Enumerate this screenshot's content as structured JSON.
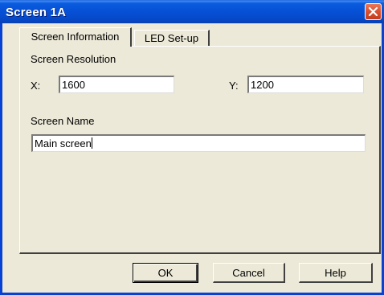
{
  "window": {
    "title": "Screen 1A",
    "close_label": "close"
  },
  "tabs": [
    {
      "label": "Screen Information",
      "active": true
    },
    {
      "label": "LED Set-up",
      "active": false
    }
  ],
  "screen_resolution": {
    "label": "Screen Resolution",
    "x_label": "X:",
    "x_value": "1600",
    "y_label": "Y:",
    "y_value": "1200"
  },
  "screen_name": {
    "label": "Screen Name",
    "value": "Main screen"
  },
  "buttons": {
    "ok": "OK",
    "cancel": "Cancel",
    "help": "Help"
  },
  "colors": {
    "titlebar": "#0650d6",
    "dialog_face": "#ece9d8",
    "close_button": "#d8502f"
  }
}
